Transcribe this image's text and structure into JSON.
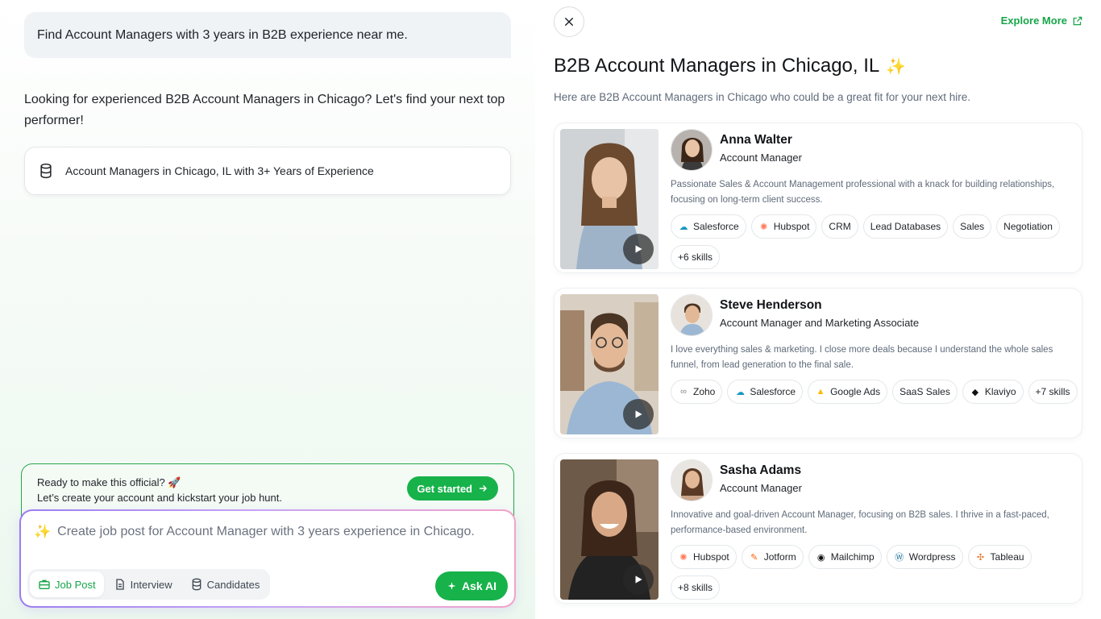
{
  "chat": {
    "user_query": "Find Account Managers with 3 years in B2B experience near me.",
    "assistant_reply": "Looking for experienced B2B Account Managers in Chicago? Let's find your next top performer!",
    "dataset_label": "Account Managers in Chicago, IL with 3+ Years of Experience"
  },
  "cta": {
    "line1": "Ready to make this official? 🚀",
    "line2": "Let’s create your account and kickstart your job hunt.",
    "button": "Get started"
  },
  "composer": {
    "placeholder": "Create job post for Account Manager with 3 years experience in Chicago.",
    "tabs": [
      "Job Post",
      "Interview",
      "Candidates"
    ],
    "ask_label": "Ask AI"
  },
  "panel": {
    "explore": "Explore More",
    "title": "B2B Account Managers in Chicago, IL",
    "subtitle": "Here are B2B Account Managers in Chicago who could be a great fit for your next hire."
  },
  "candidates": [
    {
      "name": "Anna Walter",
      "role": "Account Manager",
      "bio": "Passionate Sales & Account Management professional with a knack for building relationships, focusing on long-term client success.",
      "skills": [
        "Salesforce",
        "Hubspot",
        "CRM",
        "Lead Databases",
        "Sales",
        "Negotiation"
      ],
      "more": "+6 skills"
    },
    {
      "name": "Steve Henderson",
      "role": "Account Manager and Marketing Associate",
      "bio": "I love everything sales & marketing. I close more deals because I understand the whole sales funnel, from lead generation to the final sale.",
      "skills": [
        "Zoho",
        "Salesforce",
        "Google Ads",
        "SaaS Sales",
        "Klaviyo"
      ],
      "more": "+7 skills"
    },
    {
      "name": "Sasha Adams",
      "role": "Account Manager",
      "bio": "Innovative and goal-driven Account Manager, focusing on B2B sales. I thrive in a fast-paced, performance-based environment.",
      "skills": [
        "Hubspot",
        "Jotform",
        "Mailchimp",
        "Wordpress",
        "Tableau"
      ],
      "more": "+8 skills"
    }
  ],
  "colors": {
    "accent": "#17b24a",
    "text": "#1f2328",
    "muted": "#5f6b7a"
  }
}
